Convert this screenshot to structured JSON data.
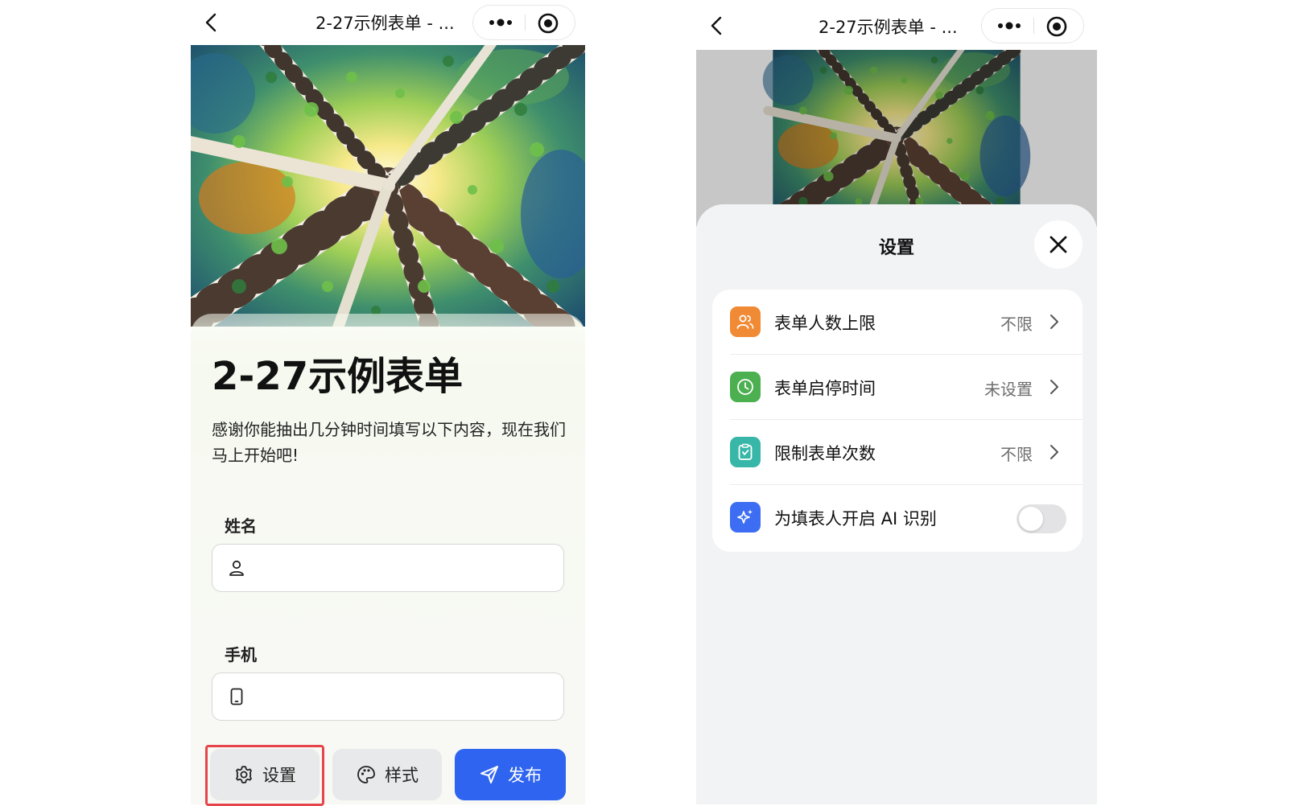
{
  "left_screen": {
    "navbar": {
      "title": "2-27示例表单 - ..."
    },
    "form": {
      "title": "2-27示例表单",
      "description": "感谢你能抽出几分钟时间填写以下内容，现在我们马上开始吧!",
      "fields": [
        {
          "label": "姓名",
          "icon": "person-icon",
          "value": ""
        },
        {
          "label": "手机",
          "icon": "phone-icon",
          "value": ""
        }
      ]
    },
    "toolbar": {
      "settings_label": "设置",
      "style_label": "样式",
      "publish_label": "发布"
    },
    "highlight_color": "#e5454a"
  },
  "right_screen": {
    "navbar": {
      "title": "2-27示例表单 - ..."
    },
    "sheet": {
      "title": "设置",
      "items": [
        {
          "label": "表单人数上限",
          "value": "不限",
          "icon": "people-icon",
          "icon_color": "#f08a35"
        },
        {
          "label": "表单启停时间",
          "value": "未设置",
          "icon": "clock-icon",
          "icon_color": "#4caf50"
        },
        {
          "label": "限制表单次数",
          "value": "不限",
          "icon": "clipboard-icon",
          "icon_color": "#38b7a8"
        },
        {
          "label": "为填表人开启 AI 识别",
          "icon": "sparkle-icon",
          "icon_color": "#3d6df2",
          "toggle_on": false
        }
      ]
    }
  },
  "colors": {
    "accent": "#2e64ef",
    "sheet_background": "#f2f3f5",
    "button_gray": "#e8e9ea"
  }
}
